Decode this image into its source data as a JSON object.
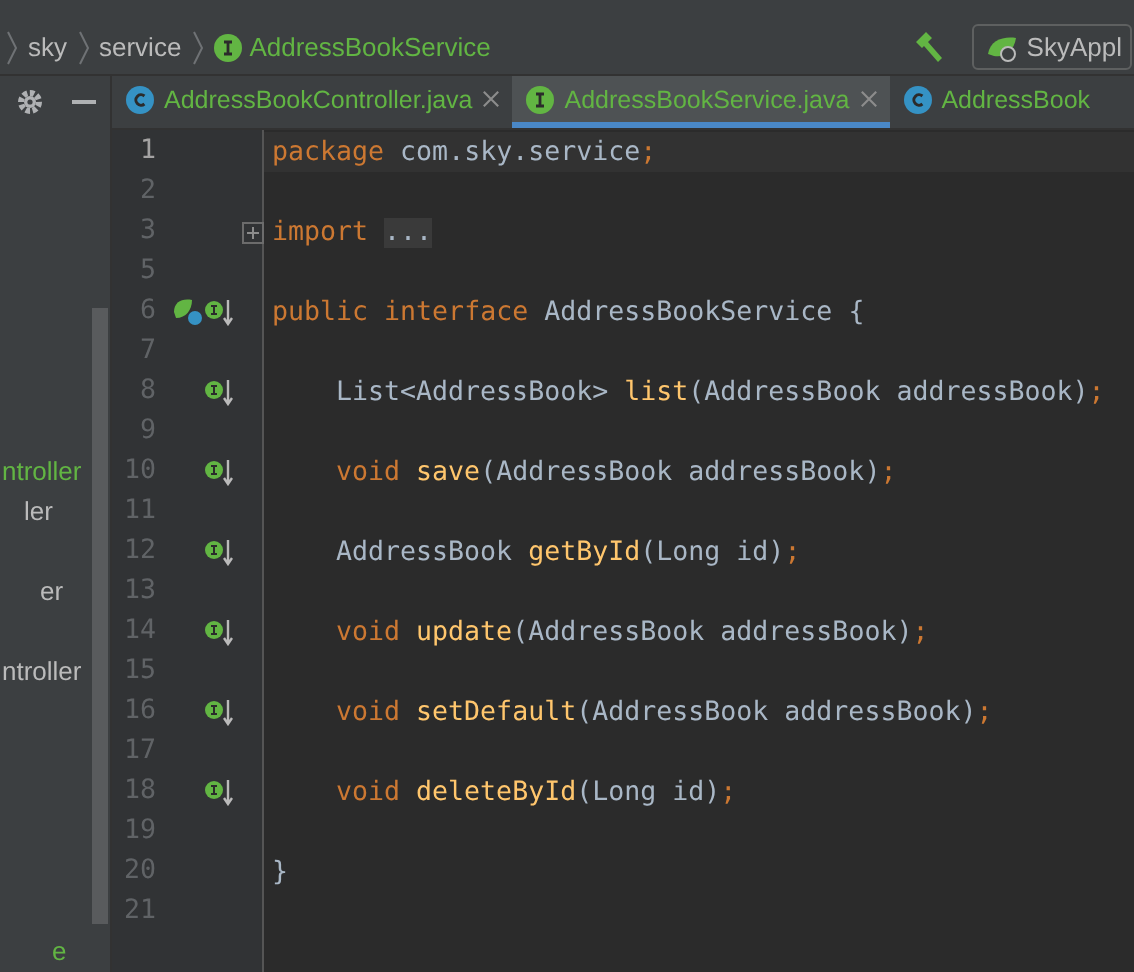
{
  "breadcrumb": [
    {
      "label": "sky",
      "kind": "folder"
    },
    {
      "label": "service",
      "kind": "folder"
    },
    {
      "label": "AddressBookService",
      "kind": "interface"
    }
  ],
  "run_config": {
    "label": "SkyAppl"
  },
  "project_panel": {
    "items": [
      {
        "label": "ntroller",
        "color": "#62b543"
      },
      {
        "label": "ler",
        "color": "#bbbbbb"
      },
      {
        "label": "er",
        "color": "#bbbbbb"
      },
      {
        "label": "ntroller",
        "color": "#bbbbbb"
      },
      {
        "label": "e",
        "color": "#62b543"
      }
    ]
  },
  "tabs": [
    {
      "label": "AddressBookController.java",
      "kind": "class",
      "selected": false,
      "closable": true
    },
    {
      "label": "AddressBookService.java",
      "kind": "interface",
      "selected": true,
      "closable": true
    },
    {
      "label": "AddressBook",
      "kind": "class",
      "selected": false
    }
  ],
  "editor": {
    "lines": [
      {
        "number": "1",
        "current": true,
        "tokens": [
          {
            "kind": "keyword",
            "text": "package "
          },
          {
            "kind": "plain",
            "text": "com.sky.service"
          },
          {
            "kind": "keyword",
            "text": ";"
          }
        ]
      },
      {
        "number": "2",
        "current": false
      },
      {
        "number": "3",
        "current": false,
        "foldable": true,
        "tokens": [
          {
            "kind": "keyword",
            "text": "import "
          },
          {
            "kind": "folded",
            "text": "..."
          }
        ]
      },
      {
        "number": "5",
        "current": false
      },
      {
        "number": "6",
        "current": false,
        "bean": true,
        "implemented": true,
        "tokens": [
          {
            "kind": "keyword",
            "text": "public interface "
          },
          {
            "kind": "plain",
            "text": "AddressBookService {"
          }
        ]
      },
      {
        "number": "7",
        "current": false
      },
      {
        "number": "8",
        "current": false,
        "implemented": true,
        "indent": true,
        "tokens": [
          {
            "kind": "plain",
            "text": "List<AddressBook> "
          },
          {
            "kind": "method",
            "text": "list"
          },
          {
            "kind": "plain",
            "text": "(AddressBook addressBook)"
          },
          {
            "kind": "keyword",
            "text": ";"
          }
        ]
      },
      {
        "number": "9",
        "current": false
      },
      {
        "number": "10",
        "current": false,
        "implemented": true,
        "indent": true,
        "tokens": [
          {
            "kind": "keyword",
            "text": "void "
          },
          {
            "kind": "method",
            "text": "save"
          },
          {
            "kind": "plain",
            "text": "(AddressBook addressBook)"
          },
          {
            "kind": "keyword",
            "text": ";"
          }
        ]
      },
      {
        "number": "11",
        "current": false
      },
      {
        "number": "12",
        "current": false,
        "implemented": true,
        "indent": true,
        "tokens": [
          {
            "kind": "plain",
            "text": "AddressBook "
          },
          {
            "kind": "method",
            "text": "getById"
          },
          {
            "kind": "plain",
            "text": "(Long id)"
          },
          {
            "kind": "keyword",
            "text": ";"
          }
        ]
      },
      {
        "number": "13",
        "current": false
      },
      {
        "number": "14",
        "current": false,
        "implemented": true,
        "indent": true,
        "tokens": [
          {
            "kind": "keyword",
            "text": "void "
          },
          {
            "kind": "method",
            "text": "update"
          },
          {
            "kind": "plain",
            "text": "(AddressBook addressBook)"
          },
          {
            "kind": "keyword",
            "text": ";"
          }
        ]
      },
      {
        "number": "15",
        "current": false
      },
      {
        "number": "16",
        "current": false,
        "implemented": true,
        "indent": true,
        "tokens": [
          {
            "kind": "keyword",
            "text": "void "
          },
          {
            "kind": "method",
            "text": "setDefault"
          },
          {
            "kind": "plain",
            "text": "(AddressBook addressBook)"
          },
          {
            "kind": "keyword",
            "text": ";"
          }
        ]
      },
      {
        "number": "17",
        "current": false
      },
      {
        "number": "18",
        "current": false,
        "implemented": true,
        "indent": true,
        "tokens": [
          {
            "kind": "keyword",
            "text": "void "
          },
          {
            "kind": "method",
            "text": "deleteById"
          },
          {
            "kind": "plain",
            "text": "(Long id)"
          },
          {
            "kind": "keyword",
            "text": ";"
          }
        ]
      },
      {
        "number": "19",
        "current": false
      },
      {
        "number": "20",
        "current": false,
        "tokens": [
          {
            "kind": "plain",
            "text": "}"
          }
        ]
      },
      {
        "number": "21",
        "current": false
      }
    ]
  }
}
